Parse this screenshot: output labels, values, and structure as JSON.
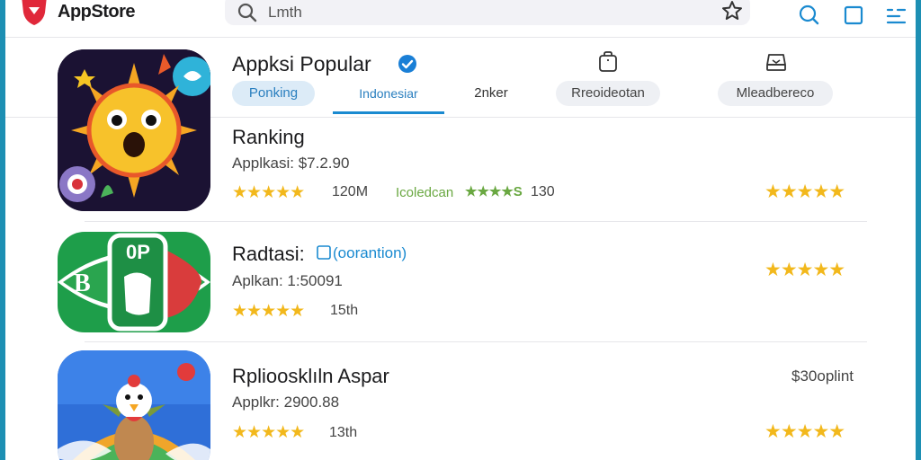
{
  "topbar": {
    "app_name": "AppStore",
    "search_text": "Lmth",
    "icons": [
      "logo-icon",
      "search-icon",
      "star-icon",
      "search-icon",
      "square-icon",
      "menu-icon"
    ]
  },
  "header": {
    "title": "Appksi Popular",
    "verified_icon": "verified-check-icon",
    "tabs": [
      {
        "label": "Ponking"
      },
      {
        "label": "Indonesiar"
      },
      {
        "label": "2nker"
      },
      {
        "label": "Rreoideotan"
      },
      {
        "label": "Mleadbereco"
      }
    ],
    "active_tab": 1
  },
  "apps": [
    {
      "title": "Ranking",
      "subtitle": "Applkasi: $7.2.90",
      "size": "120M",
      "category": "Icoledcan",
      "badge": "★★★★S",
      "count": "130",
      "rating_stars": "★★★★★",
      "rating_right": "★★★★★"
    },
    {
      "title": "Radtasi:",
      "link": "(oorantion)",
      "subtitle": "Aplkan: 1:50091",
      "count": "15th",
      "rating_stars": "★★★★★",
      "rating_right": "★★★★★"
    },
    {
      "title": "Rplioosklıln Aspar",
      "price": "$30oplint",
      "subtitle": "Applkr: 2900.88",
      "count": "13th",
      "rating_stars": "★★★★★",
      "rating_right": "★★★★★"
    }
  ],
  "colors": {
    "accent": "#1a8ad0",
    "star": "#f2b81c",
    "edge": "#1d8fb3",
    "green": "#6aa842"
  }
}
